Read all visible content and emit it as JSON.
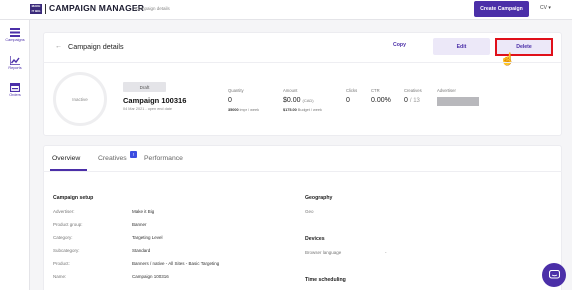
{
  "header": {
    "logo_text": "MAKE IT BIG",
    "app_title": "CAMPAIGN MANAGER",
    "breadcrumb": "Campaign details",
    "create_button": "Create Campaign",
    "user_initials": "CV"
  },
  "sidebar": {
    "items": [
      {
        "label": "Campaigns",
        "icon": "list-icon"
      },
      {
        "label": "Reports",
        "icon": "chart-icon"
      },
      {
        "label": "Orders",
        "icon": "orders-icon"
      }
    ]
  },
  "details": {
    "title": "Campaign details",
    "copy_label": "Copy",
    "edit_label": "Edit",
    "delete_label": "Delete",
    "status_circle": "Inactive",
    "badge": "Draft",
    "campaign_name": "Campaign 100316",
    "campaign_dates": "04 Mar 2021 - open end date",
    "stats": {
      "quantity_label": "Quantity",
      "quantity_value": "0",
      "quantity_sub_bold": "35000",
      "quantity_sub": "impr / week",
      "amount_label": "Amount",
      "amount_value": "$0.00",
      "amount_currency": "(CAD)",
      "amount_sub_bold": "$175.00",
      "amount_sub": "Budget / week",
      "clicks_label": "Clicks",
      "clicks_value": "0",
      "ctr_label": "CTR",
      "ctr_value": "0.00%",
      "creatives_label": "Creatives",
      "creatives_value": "0",
      "creatives_total": "/ 13",
      "advertiser_label": "Advertiser"
    }
  },
  "tabs": {
    "overview": "Overview",
    "creatives": "Creatives",
    "creatives_badge": "!",
    "performance": "Performance"
  },
  "campaign_setup": {
    "title": "Campaign setup",
    "rows": [
      {
        "label": "Advertiser:",
        "value": "Make it Big"
      },
      {
        "label": "Product group:",
        "value": "Banner"
      },
      {
        "label": "Category:",
        "value": "Targeting Level"
      },
      {
        "label": "Subcategory:",
        "value": "Standard"
      },
      {
        "label": "Product:",
        "value": "Banners / native - All Sites - Basic Targeting"
      },
      {
        "label": "Name:",
        "value": "Campaign 100316"
      }
    ]
  },
  "geography": {
    "title": "Geography",
    "label": "Geo"
  },
  "devices": {
    "title": "Devices",
    "label": "Browser language",
    "value": "-"
  },
  "time_scheduling": {
    "title": "Time scheduling"
  }
}
